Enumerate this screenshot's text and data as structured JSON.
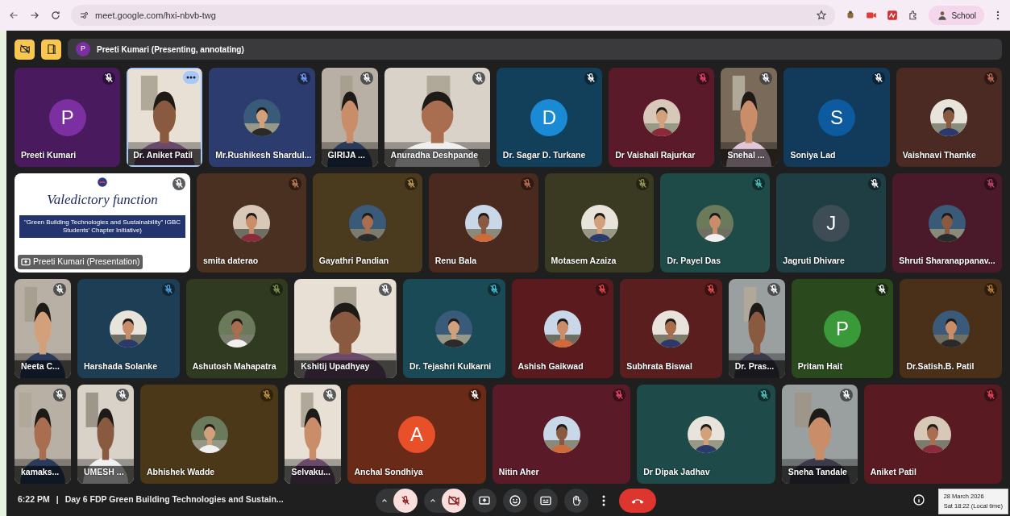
{
  "browser": {
    "url": "meet.google.com/hxi-nbvb-twg",
    "profile": "School"
  },
  "meeting": {
    "presenter_initial": "P",
    "presenter_status": "Preeti Kumari (Presenting, annotating)"
  },
  "rows": [
    {
      "tiles": [
        {
          "kind": "letter",
          "name": "Preeti Kumari",
          "color": "#4a1a5e",
          "avatar": {
            "initial": "P",
            "color": "#7b2fa0"
          },
          "selected": false
        },
        {
          "kind": "video-medium",
          "name": "Dr. Aniket Patil",
          "selected": true
        },
        {
          "kind": "avatar",
          "name": "Mr.Rushikesh Shardul...",
          "color": "#2d3c6e",
          "selected": false
        },
        {
          "kind": "video-narrow",
          "name": "GIRIJA ...",
          "selected": false
        },
        {
          "kind": "video",
          "name": "Anuradha Deshpande",
          "selected": false
        },
        {
          "kind": "letter",
          "name": "Dr. Sagar D. Turkane",
          "color": "#123f5a",
          "avatar": {
            "initial": "D",
            "color": "#1a8ad4"
          },
          "selected": false
        },
        {
          "kind": "avatar",
          "name": "Dr Vaishali Rajurkar",
          "color": "#5a1a2a",
          "selected": false
        },
        {
          "kind": "video-narrow",
          "name": "Snehal ...",
          "selected": false
        },
        {
          "kind": "letter",
          "name": "Soniya Lad",
          "color": "#123a5a",
          "avatar": {
            "initial": "S",
            "color": "#0d5a9e"
          },
          "selected": false
        },
        {
          "kind": "avatar",
          "name": "Vaishnavi Thamke",
          "color": "#4a2a22",
          "selected": false
        }
      ]
    },
    {
      "tiles": [
        {
          "kind": "presentation",
          "name": "Preeti Kumari (Presentation)",
          "slide": {
            "title": "Valedictory function",
            "subtitle": "\"Green Building Technologies and Sustainability\" IGBC Students' Chapter Initiative)"
          },
          "selected": false
        },
        {
          "kind": "avatar",
          "name": "smita daterao",
          "color": "#4a3020",
          "selected": false
        },
        {
          "kind": "avatar",
          "name": "Gayathri Pandian",
          "color": "#4a3a1e",
          "selected": false
        },
        {
          "kind": "avatar",
          "name": "Renu Bala",
          "color": "#4a2a1e",
          "selected": false
        },
        {
          "kind": "avatar",
          "name": "Motasem Azaiza",
          "color": "#3a3a22",
          "selected": false
        },
        {
          "kind": "avatar",
          "name": "Dr. Payel Das",
          "color": "#1e4a48",
          "selected": false
        },
        {
          "kind": "letter",
          "name": "Jagruti Dhivare",
          "color": "#1e3e44",
          "avatar": {
            "initial": "J",
            "color": "#3e4c56"
          },
          "selected": false
        },
        {
          "kind": "avatar",
          "name": "Shruti Sharanappanav...",
          "color": "#4a1a2a",
          "selected": false
        }
      ]
    },
    {
      "tiles": [
        {
          "kind": "video-narrow",
          "name": "Neeta C...",
          "selected": false
        },
        {
          "kind": "avatar",
          "name": "Harshada Solanke",
          "color": "#1e3e55",
          "selected": false
        },
        {
          "kind": "avatar",
          "name": "Ashutosh Mahapatra",
          "color": "#303a20",
          "selected": false
        },
        {
          "kind": "video",
          "name": "Kshitij Upadhyay",
          "selected": false
        },
        {
          "kind": "avatar",
          "name": "Dr. Tejashri Kulkarni",
          "color": "#1a4a55",
          "selected": false
        },
        {
          "kind": "avatar",
          "name": "Ashish Gaikwad",
          "color": "#5a1a1e",
          "selected": false
        },
        {
          "kind": "avatar",
          "name": "Subhrata Biswal",
          "color": "#5a1e1e",
          "selected": false
        },
        {
          "kind": "video-narrow",
          "name": "Dr. Pras...",
          "selected": false
        },
        {
          "kind": "letter",
          "name": "Pritam Hait",
          "color": "#2a4a1e",
          "avatar": {
            "initial": "P",
            "color": "#3a9a3a"
          },
          "selected": false
        },
        {
          "kind": "avatar",
          "name": "Dr.Satish.B. Patil",
          "color": "#4a3018",
          "selected": false
        }
      ]
    },
    {
      "tiles": [
        {
          "kind": "video-narrow",
          "name": "kamaks...",
          "selected": false
        },
        {
          "kind": "video-narrow",
          "name": "UMESH ...",
          "selected": false
        },
        {
          "kind": "avatar",
          "name": "Abhishek Wadde",
          "color": "#4a3818",
          "selected": false
        },
        {
          "kind": "video-narrow",
          "name": "Selvaku...",
          "selected": false
        },
        {
          "kind": "letter",
          "name": "Anchal Sondhiya",
          "color": "#6a2a18",
          "avatar": {
            "initial": "A",
            "color": "#e8502a"
          },
          "selected": false
        },
        {
          "kind": "avatar",
          "name": "Nitin Aher",
          "color": "#5a1a28",
          "selected": false
        },
        {
          "kind": "avatar",
          "name": "Dr Dipak Jadhav",
          "color": "#1e4a4a",
          "selected": false
        },
        {
          "kind": "video-medium",
          "name": "Sneha Tandale",
          "selected": false
        },
        {
          "kind": "avatar",
          "name": "Aniket Patil",
          "color": "#5a1a22",
          "selected": false
        }
      ]
    }
  ],
  "footer": {
    "time": "6:22 PM",
    "separator": "|",
    "title": "Day 6 FDP Green Building Technologies and Sustain...",
    "mic_on": false,
    "camera_on": false
  },
  "clock": {
    "date": "28 March 2026",
    "time": "Sat 18:22 (Local time)"
  }
}
